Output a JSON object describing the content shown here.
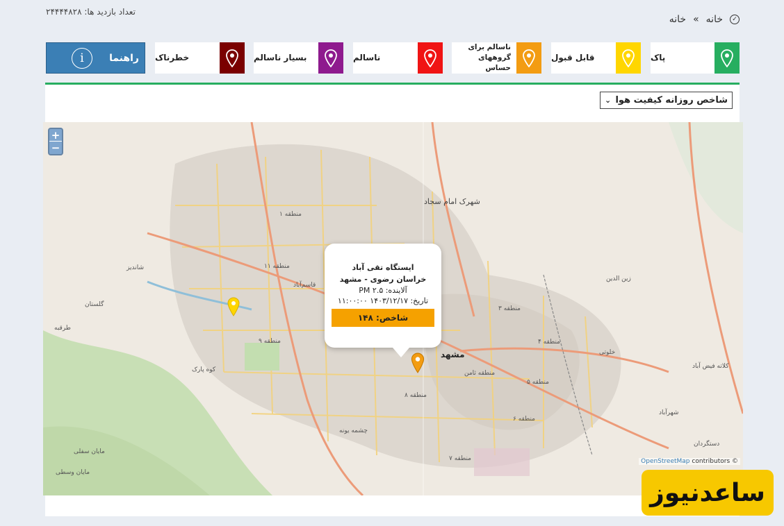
{
  "header": {
    "visit_counter": "تعداد بازدید ها: ۲۴۴۴۴۸۲۸",
    "breadcrumb": [
      "خانه",
      "»",
      "خانه"
    ]
  },
  "legend": [
    {
      "label": "پاک",
      "color": "#27ae60"
    },
    {
      "label": "قابل قبول",
      "color": "#ffd600"
    },
    {
      "label": "ناسالم برای\nگروههای حساس",
      "color": "#f39c12"
    },
    {
      "label": "ناسالم",
      "color": "#f01414"
    },
    {
      "label": "بسیار ناسالم",
      "color": "#8e1a8e"
    },
    {
      "label": "خطرناک",
      "color": "#7a0000"
    }
  ],
  "guide_button": {
    "label": "راهنما",
    "icon": "info-icon"
  },
  "index_select": {
    "selected": "شاخص روزانه کیفیت هوا"
  },
  "map": {
    "zoom_in": "+",
    "zoom_out": "−",
    "attribution_link": "OpenStreetMap",
    "attribution_text": "contributors ©",
    "city_label": "مشهد",
    "labels": [
      {
        "text": "منطقه ۱"
      },
      {
        "text": "منطقه ۱۱"
      },
      {
        "text": "منطقه ۳"
      },
      {
        "text": "منطقه ۴"
      },
      {
        "text": "منطقه ۵"
      },
      {
        "text": "منطقه ۶"
      },
      {
        "text": "منطقه ۷"
      },
      {
        "text": "منطقه ۸"
      },
      {
        "text": "منطقه ۹"
      },
      {
        "text": "منطقه ثامن"
      },
      {
        "text": "شهرک امام سجاد"
      },
      {
        "text": "گلستان"
      },
      {
        "text": "کوه پارک"
      },
      {
        "text": "شاندیز"
      },
      {
        "text": "طرقبه"
      },
      {
        "text": "قاسم‌آباد"
      },
      {
        "text": "چشمه یونه"
      },
      {
        "text": "مایان سفلی"
      },
      {
        "text": "مایان وسطی"
      },
      {
        "text": "خلوتی"
      },
      {
        "text": "کلاته فیض آباد"
      },
      {
        "text": "شهرآباد"
      },
      {
        "text": "دستگردان"
      },
      {
        "text": "زین الدین"
      }
    ]
  },
  "popup": {
    "station": "ایستگاه تقی آباد",
    "province": "خراسان رضوی - مشهد",
    "pollutant": "آلاینده: PM ۲.۵",
    "date": "تاریخ: ۱۴۰۳/۱۲/۱۷ ۱۱:۰۰:۰۰",
    "aqi": "شاخص: ۱۴۸"
  },
  "markers": [
    {
      "name": "taghiabad-marker",
      "color": "#f39c12"
    },
    {
      "name": "station-marker-west",
      "color": "#ffd600"
    }
  ],
  "watermark": "ساعدنیوز"
}
